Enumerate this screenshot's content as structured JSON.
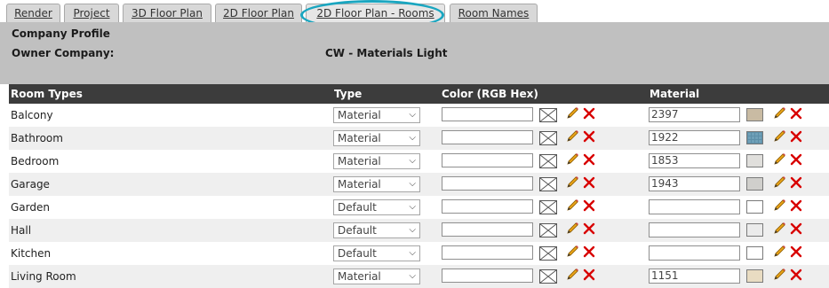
{
  "tabs": [
    {
      "label": "Render",
      "active": false
    },
    {
      "label": "Project",
      "active": false
    },
    {
      "label": "3D Floor Plan",
      "active": false
    },
    {
      "label": "2D Floor Plan",
      "active": false
    },
    {
      "label": "2D Floor Plan - Rooms",
      "active": true
    },
    {
      "label": "Room Names",
      "active": false
    }
  ],
  "profile": {
    "title": "Company Profile",
    "owner_label": "Owner Company:",
    "owner_value": "CW - Materials Light"
  },
  "table": {
    "headers": {
      "room_types": "Room Types",
      "type": "Type",
      "color": "Color (RGB Hex)",
      "material": "Material"
    },
    "rows": [
      {
        "name": "Balcony",
        "type": "Material",
        "color": "",
        "material": "2397",
        "swatch": "#c9bba3"
      },
      {
        "name": "Bathroom",
        "type": "Material",
        "color": "",
        "material": "1922",
        "swatch": "#6fa0b8"
      },
      {
        "name": "Bedroom",
        "type": "Material",
        "color": "",
        "material": "1853",
        "swatch": "#e0dfdc"
      },
      {
        "name": "Garage",
        "type": "Material",
        "color": "",
        "material": "1943",
        "swatch": "#d0cfcc"
      },
      {
        "name": "Garden",
        "type": "Default",
        "color": "",
        "material": "",
        "swatch": "#ffffff"
      },
      {
        "name": "Hall",
        "type": "Default",
        "color": "",
        "material": "",
        "swatch": "#ebebeb"
      },
      {
        "name": "Kitchen",
        "type": "Default",
        "color": "",
        "material": "",
        "swatch": "#ffffff"
      },
      {
        "name": "Living Room",
        "type": "Material",
        "color": "",
        "material": "1151",
        "swatch": "#e9dcc2"
      }
    ]
  },
  "colors": {
    "highlight": "#1aa6c0",
    "header_bg": "#3c3c3c",
    "panel_bg": "#c0c0c0",
    "delete": "#d80000",
    "pencil": "#e8a317"
  },
  "icons": {
    "clear": "envelope-icon",
    "edit": "pencil-icon",
    "delete": "close-icon",
    "dropdown": "chevron-down-icon"
  }
}
